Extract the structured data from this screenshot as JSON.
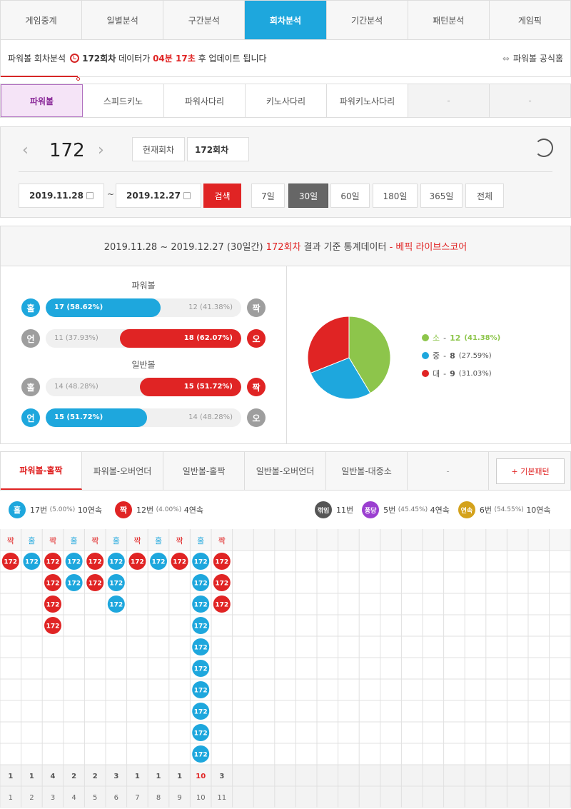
{
  "nav": {
    "tabs": [
      "게임중계",
      "일별분석",
      "구간분석",
      "회차분석",
      "기간분석",
      "패턴분석",
      "게임픽"
    ],
    "active": 3
  },
  "info": {
    "prefix": "파워볼 회차분석",
    "round": "172회차",
    "mid": "데이터가",
    "time": "04분 17초",
    "suffix": "후 업데이트 됩니다",
    "official": "파워볼 공식홈"
  },
  "subtabs": {
    "items": [
      "파워볼",
      "스피드키노",
      "파워사다리",
      "키노사다리",
      "파워키노사다리",
      "-",
      "-"
    ],
    "active": 0
  },
  "ctrl": {
    "round": "172",
    "prev": "‹",
    "next": "›",
    "current_label": "현재회차",
    "round_input": "172회차",
    "date_from": "2019.11.28",
    "tilde": "~",
    "date_to": "2019.12.27",
    "search": "검색",
    "periods": [
      "7일",
      "30일",
      "60일",
      "180일",
      "365일",
      "전체"
    ],
    "active_period": 1
  },
  "stats": {
    "head_dates": "2019.11.28 ~ 2019.12.27 (30일간)",
    "head_round": "172회차",
    "head_mid": "결과 기준 통계데이터",
    "head_brand": "- 베픽 라이브스코어",
    "power_title": "파워볼",
    "normal_title": "일반볼",
    "rows": [
      {
        "left_ball": "홀",
        "right_ball": "짝",
        "left_text": "17 (58.62%)",
        "right_text": "12 (41.38%)",
        "fill": 58.62,
        "side": "left"
      },
      {
        "left_ball": "언",
        "right_ball": "오",
        "left_text": "11 (37.93%)",
        "right_text": "18 (62.07%)",
        "fill": 62.07,
        "side": "right"
      },
      {
        "left_ball": "홀",
        "right_ball": "짝",
        "left_text": "14 (48.28%)",
        "right_text": "15 (51.72%)",
        "fill": 51.72,
        "side": "right"
      },
      {
        "left_ball": "언",
        "right_ball": "오",
        "left_text": "15 (51.72%)",
        "right_text": "14 (48.28%)",
        "fill": 51.72,
        "side": "left"
      }
    ],
    "pie": [
      {
        "label": "소",
        "count": "12",
        "pct": "(41.38%)",
        "value": 41.38,
        "color": "#8dc54b"
      },
      {
        "label": "중",
        "count": "8",
        "pct": "(27.59%)",
        "value": 27.59,
        "color": "#1ea7dd"
      },
      {
        "label": "대",
        "count": "9",
        "pct": "(31.03%)",
        "value": 31.03,
        "color": "#e02424"
      }
    ]
  },
  "pattern_tabs": {
    "items": [
      "파워볼-홀짝",
      "파워볼-오버언더",
      "일반볼-홀짝",
      "일반볼-오버언더",
      "일반볼-대중소",
      "-"
    ],
    "active": 0,
    "basic": "+ 기본패턴"
  },
  "summary": {
    "odd_ball": "홀",
    "odd_text": "17번",
    "odd_pct": "(5.00%)",
    "odd_streak": "10연속",
    "even_ball": "짝",
    "even_text": "12번",
    "even_pct": "(4.00%)",
    "even_streak": "4연속",
    "brk_ball": "꺾임",
    "brk_text": "11번",
    "pong_ball": "퐁당",
    "pong_text": "5번",
    "pong_pct": "(45.45%)",
    "pong_streak": "4연속",
    "cont_ball": "연속",
    "cont_text": "6번",
    "cont_pct": "(54.55%)",
    "cont_streak": "10연속"
  },
  "pattern": {
    "ball_label": "172",
    "columns": [
      {
        "head": "짝",
        "count": 1
      },
      {
        "head": "홀",
        "count": 1
      },
      {
        "head": "짝",
        "count": 4
      },
      {
        "head": "홀",
        "count": 2
      },
      {
        "head": "짝",
        "count": 2
      },
      {
        "head": "홀",
        "count": 3
      },
      {
        "head": "짝",
        "count": 1
      },
      {
        "head": "홀",
        "count": 1
      },
      {
        "head": "짝",
        "count": 1
      },
      {
        "head": "홀",
        "count": 10
      },
      {
        "head": "짝",
        "count": 3
      }
    ],
    "index": [
      "1",
      "2",
      "3",
      "4",
      "5",
      "6",
      "7",
      "8",
      "9",
      "10",
      "11"
    ],
    "colors": {
      "odd": "#1ea7dd",
      "even": "#e02424"
    }
  }
}
